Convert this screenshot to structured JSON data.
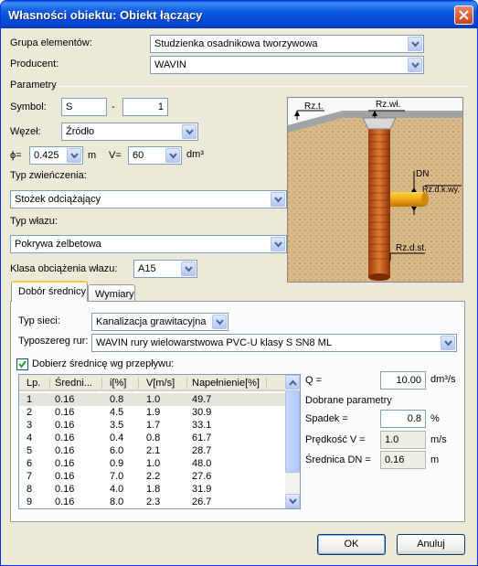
{
  "window": {
    "title": "Własności obiektu: Obiekt łączący"
  },
  "top": {
    "grupa_label": "Grupa elementów:",
    "grupa_value": "Studzienka osadnikowa tworzywowa",
    "producent_label": "Producent:",
    "producent_value": "WAVIN"
  },
  "parametry": {
    "section_label": "Parametry",
    "symbol_label": "Symbol:",
    "symbol_value": "S",
    "symbol_sep": "-",
    "symbol_num": "1",
    "wezel_label": "Węzeł:",
    "wezel_value": "Źródło",
    "phi_label": "ϕ=",
    "phi_value": "0.425",
    "phi_unit": "m",
    "v_label": "V=",
    "v_value": "60",
    "v_unit": "dm³",
    "typ_zwienczenia_label": "Typ zwieńczenia:",
    "typ_zwienczenia_value": "Stożek odciążający",
    "typ_wlazu_label": "Typ włazu:",
    "typ_wlazu_value": "Pokrywa żelbetowa",
    "klasa_label": "Klasa obciążenia włazu:",
    "klasa_value": "A15"
  },
  "diagram": {
    "labels": {
      "rzt": "Rz.t.",
      "rzwl": "Rz.wł.",
      "dn": "DN",
      "rzdkwy": "Rz.d.k.wy.",
      "rzdst": "Rz.d.st."
    }
  },
  "tabs": [
    {
      "label": "Dobór średnicy"
    },
    {
      "label": "Wymiary"
    }
  ],
  "dobor": {
    "typ_sieci_label": "Typ sieci:",
    "typ_sieci_value": "Kanalizacja grawitacyjna",
    "typoszereg_label": "Typoszereg rur:",
    "typoszereg_value": "WAVIN rury wielowarstwowa PVC-U klasy S SN8 ML",
    "checkbox_label": "Dobierz średnicę wg przepływu:",
    "checkbox_checked": true,
    "table": {
      "columns": [
        "Lp.",
        "Średni...",
        "i[%]",
        "V[m/s]",
        "Napełnienie[%]"
      ],
      "rows": [
        [
          "1",
          "0.16",
          "0.8",
          "1.0",
          "49.7"
        ],
        [
          "2",
          "0.16",
          "4.5",
          "1.9",
          "30.9"
        ],
        [
          "3",
          "0.16",
          "3.5",
          "1.7",
          "33.1"
        ],
        [
          "4",
          "0.16",
          "0.4",
          "0.8",
          "61.7"
        ],
        [
          "5",
          "0.16",
          "6.0",
          "2.1",
          "28.7"
        ],
        [
          "6",
          "0.16",
          "0.9",
          "1.0",
          "48.0"
        ],
        [
          "7",
          "0.16",
          "7.0",
          "2.2",
          "27.6"
        ],
        [
          "8",
          "0.16",
          "4.0",
          "1.8",
          "31.9"
        ],
        [
          "9",
          "0.16",
          "8.0",
          "2.3",
          "26.7"
        ]
      ]
    },
    "q_label": "Q =",
    "q_value": "10.00",
    "q_unit": "dm³/s",
    "dobrane_label": "Dobrane parametry",
    "spadek_label": "Spadek =",
    "spadek_value": "0.8",
    "spadek_unit": "%",
    "predkosc_label": "Prędkość V =",
    "predkosc_value": "1.0",
    "predkosc_unit": "m/s",
    "srednica_label": "Średnica DN =",
    "srednica_value": "0.16",
    "srednica_unit": "m"
  },
  "buttons": {
    "ok": "OK",
    "cancel": "Anuluj"
  }
}
